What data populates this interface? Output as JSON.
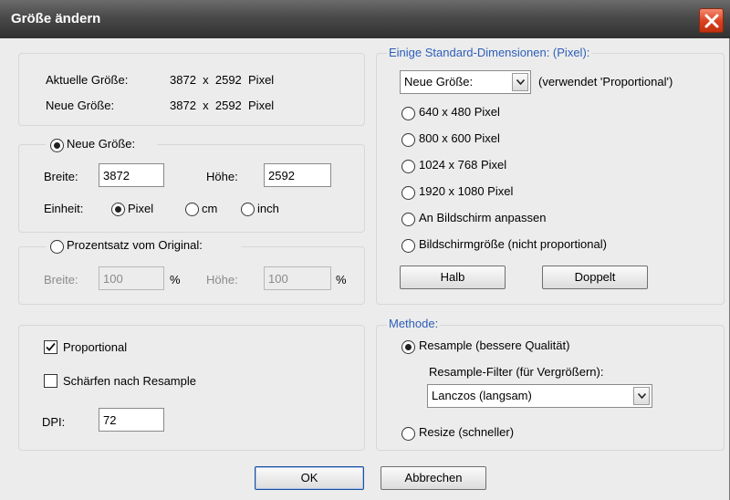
{
  "window": {
    "title": "Größe ändern"
  },
  "current": {
    "current_label": "Aktuelle Größe:",
    "current_value": "3872  x  2592  Pixel",
    "new_label": "Neue Größe:",
    "new_value": "3872  x  2592  Pixel"
  },
  "new_size": {
    "radio_label": "Neue Größe:",
    "selected": true,
    "width_label": "Breite:",
    "width_value": "3872",
    "height_label": "Höhe:",
    "height_value": "2592",
    "unit_label": "Einheit:",
    "units": [
      {
        "label": "Pixel",
        "selected": true
      },
      {
        "label": "cm",
        "selected": false
      },
      {
        "label": "inch",
        "selected": false
      }
    ]
  },
  "percent": {
    "radio_label": "Prozentsatz vom Original:",
    "selected": false,
    "width_label": "Breite:",
    "width_value": "100",
    "width_unit": "%",
    "height_label": "Höhe:",
    "height_value": "100",
    "height_unit": "%"
  },
  "options": {
    "proportional_label": "Proportional",
    "proportional_checked": true,
    "sharpen_label": "Schärfen nach Resample",
    "sharpen_checked": false,
    "dpi_label": "DPI:",
    "dpi_value": "72"
  },
  "standard": {
    "legend": "Einige Standard-Dimensionen: (Pixel):",
    "dropdown_value": "Neue Größe:",
    "dropdown_note": "(verwendet 'Proportional')",
    "presets": [
      "640 x 480 Pixel",
      "800 x 600 Pixel",
      "1024 x 768 Pixel",
      "1920 x 1080 Pixel",
      "An Bildschirm anpassen",
      "Bildschirmgröße (nicht proportional)"
    ],
    "half_label": "Halb",
    "double_label": "Doppelt"
  },
  "method": {
    "legend": "Methode:",
    "resample_label": "Resample (bessere Qualität)",
    "resample_selected": true,
    "filter_label": "Resample-Filter (für Vergrößern):",
    "filter_value": "Lanczos (langsam)",
    "resize_label": "Resize (schneller)",
    "resize_selected": false
  },
  "footer": {
    "ok_label": "OK",
    "cancel_label": "Abbrechen"
  },
  "colors": {
    "legend_blue": "#2d5fb8",
    "close_red": "#d9401f",
    "titlebar": "#4a4a4a"
  }
}
